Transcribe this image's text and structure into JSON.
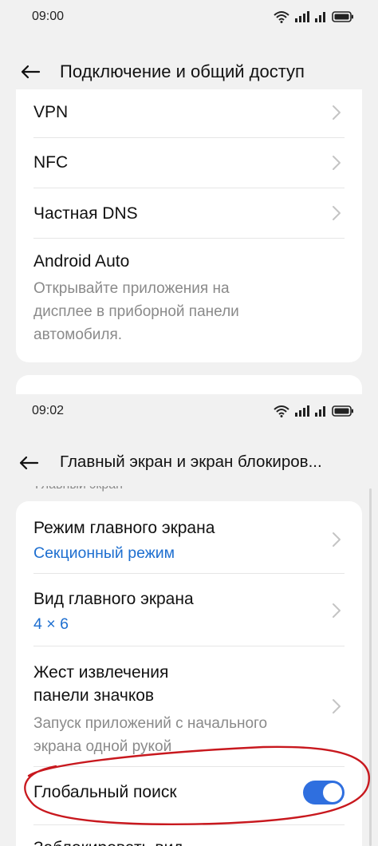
{
  "screen1": {
    "status": {
      "time": "09:00"
    },
    "title": "Подключение и общий доступ",
    "items": [
      {
        "title": "VPN"
      },
      {
        "title": "NFC"
      },
      {
        "title": "Частная DNS"
      },
      {
        "title": "Android Auto",
        "subtitle_lines": [
          "Открывайте приложения на",
          "дисплее в приборной панели",
          "автомобиля."
        ]
      }
    ]
  },
  "screen2": {
    "status": {
      "time": "09:02"
    },
    "title": "Главный экран и экран блокиров...",
    "section_label": "Главный экран",
    "items": [
      {
        "title": "Режим главного экрана",
        "value": "Секционный режим"
      },
      {
        "title": "Вид главного экрана",
        "value": "4 × 6"
      },
      {
        "title_lines": [
          "Жест извлечения",
          "панели значков"
        ],
        "subtitle_lines": [
          "Запуск приложений с начального",
          "экрана одной рукой"
        ]
      },
      {
        "title": "Глобальный поиск",
        "toggle_on": true
      },
      {
        "title": "Заблокировать вид"
      }
    ]
  },
  "colors": {
    "accent": "#2f6fdf",
    "value_text": "#1e6fd0",
    "annotation": "#c8181e",
    "background": "#f1f1f1"
  }
}
